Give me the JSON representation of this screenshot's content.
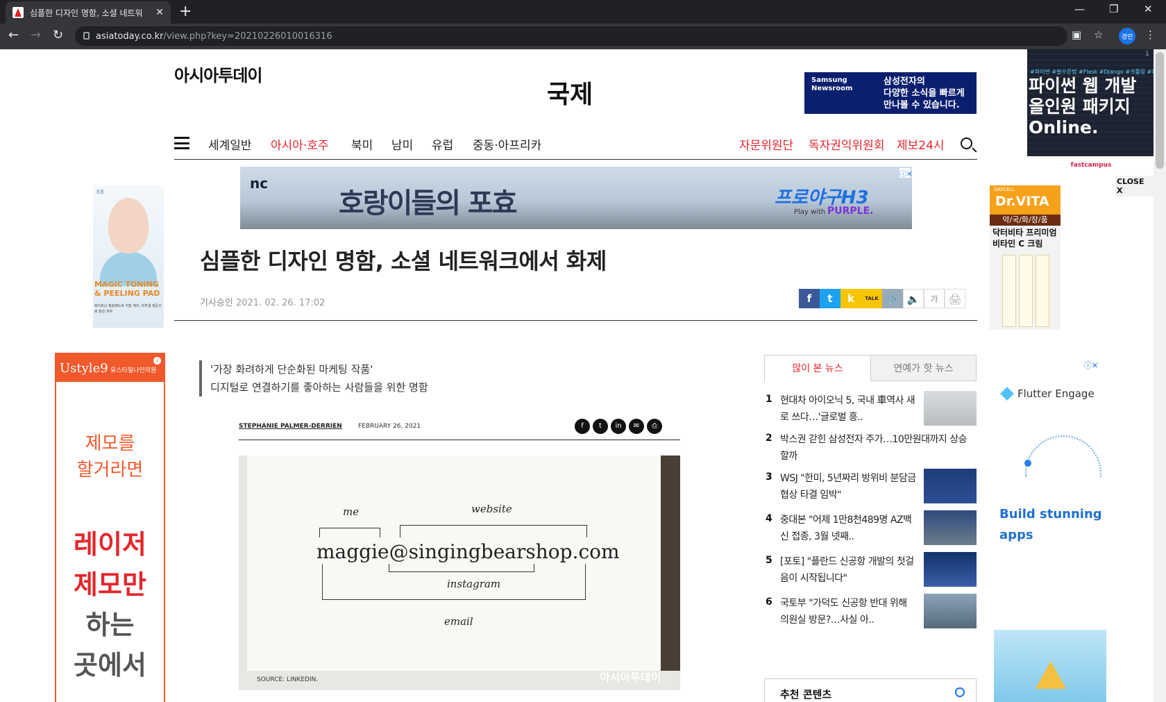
{
  "browser": {
    "tab_title": "심플한 디자인 명함, 소셜 네트워",
    "new_tab": "+",
    "url_host": "asiatoday.co.kr",
    "url_path": "/view.php?key=20210226010016316",
    "profile": "경민"
  },
  "site": {
    "logo_a": "아시아투데이",
    "section": "국제",
    "ad_samsung": {
      "brand": "Samsung Newsroom",
      "line1": "삼성전자의",
      "line2": "다양한 소식을 빠르게",
      "line3": "만나볼 수 있습니다."
    }
  },
  "nav": {
    "items": [
      "세계일반",
      "아시아·호주",
      "북미",
      "남미",
      "유럽",
      "중동·아프리카"
    ],
    "right": [
      "자문위원단",
      "독자권익위원회",
      "제보24시"
    ],
    "accent": "#e3262c"
  },
  "ads": {
    "banner": {
      "brand": "nc",
      "headline": "호랑이들의 포효",
      "game": "프로야구H3",
      "play": "Play with",
      "purple": "PURPLE."
    },
    "left_top": {
      "brand": "KB",
      "t1": "MAGIC TONING & PEELING PAD",
      "t2": "화이트닝 필링패드로 각질 케어, 피부결 정돈으로 맑은 피부"
    },
    "right_top": {
      "a": "DAYCELL",
      "b": "Dr.VITA",
      "strip": "약/국/화/장/품",
      "t3": "닥터비타 프리미엄 비타민 C 크림"
    },
    "fastcampus": {
      "tags": "#파이썬 #필수문법 #Flask #Django #크롤링 #파이썬",
      "l1": "파이썬 웹 개발",
      "l2": "올인원 패키지",
      "l3": "Online.",
      "foot": "fastcampus",
      "count": "1"
    },
    "close": "CLOSE X",
    "left_bottom": {
      "brand": "Ustyle9",
      "sub": "유스타일나인의원",
      "l1": "제모를",
      "l2": "할거라면",
      "l3": "레이저",
      "l4": "제모만",
      "l5": "하는",
      "l6": "곳에서"
    },
    "flutter": {
      "title": "Flutter Engage",
      "l1": "Build stunning",
      "l2": "apps"
    }
  },
  "article": {
    "title": "심플한 디자인 명함, 소셜 네트워크에서 화제",
    "approved_label": "기사승인",
    "approved_value": "2021. 02. 26. 17:02",
    "share": [
      "f",
      "t",
      "k",
      "TALK",
      "🔗",
      "🔈",
      "가",
      "🖨"
    ],
    "quote1": "'가장 화려하게 단순화된 마케팅 작품'",
    "quote2": "디지털로 연결하기를 좋아하는 사람들을 위한 명함",
    "byline": "STEPHANIE PALMER-DERRIEN",
    "date": "FEBRUARY 26, 2021",
    "card": {
      "email": "maggie@singingbearshop.com",
      "me": "me",
      "website": "website",
      "instagram": "instagram",
      "email_lbl": "email"
    },
    "source": "SOURCE: LINKEDIN.",
    "watermark": "아시아투데이"
  },
  "ranking": {
    "tab_active": "많이 본 뉴스",
    "tab_inactive": "연예가 핫 뉴스",
    "items": [
      {
        "n": "1",
        "text": "현대차 아이오닉 5, 국내 車역사 새로 쓰다…'글로벌 흥.."
      },
      {
        "n": "2",
        "text": "박스권 갇힌 삼성전자 주가…10만원대까지 상승할까"
      },
      {
        "n": "3",
        "text": "WSJ \"한미, 5년짜리 방위비 분담금 협상 타결 임박\""
      },
      {
        "n": "4",
        "text": "중대본 \"어제 1만8천489명 AZ백신 접종, 3월 넷째.."
      },
      {
        "n": "5",
        "text": "[포토] \"플란드 신공항 개발의 첫걸음이 시작됩니다\""
      },
      {
        "n": "6",
        "text": "국토부 \"가덕도 신공항 반대 위해 의원실 방문?…사실 아.."
      }
    ],
    "recommend": "추천 콘텐츠"
  }
}
